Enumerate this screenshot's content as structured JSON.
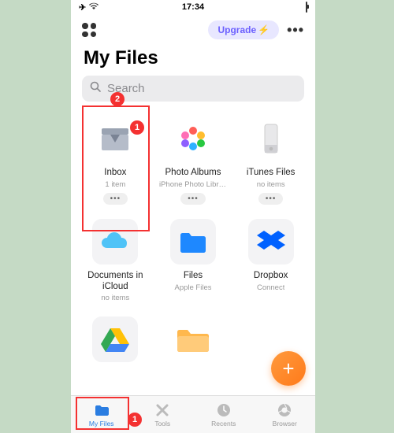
{
  "status": {
    "time": "17:34"
  },
  "upgrade_label": "Upgrade",
  "title": "My Files",
  "search_placeholder": "Search",
  "tiles": [
    {
      "label": "Inbox",
      "sub": "1 item"
    },
    {
      "label": "Photo Albums",
      "sub": "iPhone Photo Libra..."
    },
    {
      "label": "iTunes Files",
      "sub": "no items"
    },
    {
      "label": "Documents in iCloud",
      "sub": "no items"
    },
    {
      "label": "Files",
      "sub": "Apple Files"
    },
    {
      "label": "Dropbox",
      "sub": "Connect"
    }
  ],
  "tabs": [
    {
      "label": "My Files"
    },
    {
      "label": "Tools"
    },
    {
      "label": "Recents"
    },
    {
      "label": "Browser"
    }
  ],
  "annotations": {
    "inbox": "1",
    "search": "2",
    "tab": "1"
  }
}
